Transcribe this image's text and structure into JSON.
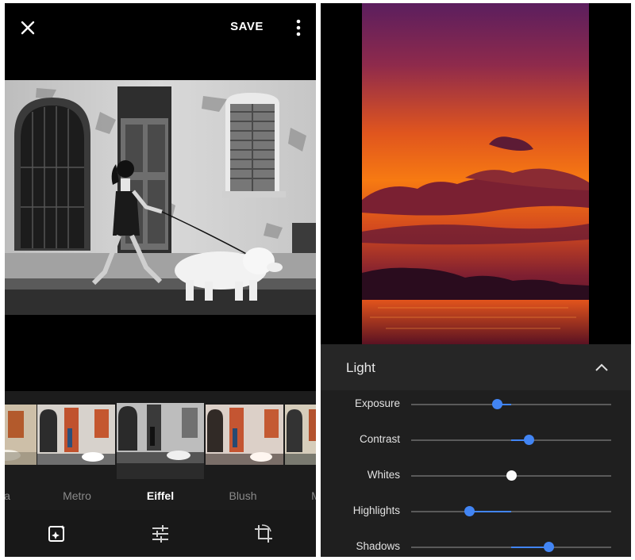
{
  "left": {
    "save_label": "SAVE",
    "filters": [
      {
        "label": "a",
        "selected": false
      },
      {
        "label": "Metro",
        "selected": false
      },
      {
        "label": "Eiffel",
        "selected": true
      },
      {
        "label": "Blush",
        "selected": false
      },
      {
        "label": "M",
        "selected": false
      }
    ]
  },
  "right": {
    "section_title": "Light",
    "sliders": [
      {
        "label": "Exposure",
        "value": 0.43,
        "center": 0.5
      },
      {
        "label": "Contrast",
        "value": 0.59,
        "center": 0.5
      },
      {
        "label": "Whites",
        "value": 0.5,
        "center": 0.5
      },
      {
        "label": "Highlights",
        "value": 0.29,
        "center": 0.5
      },
      {
        "label": "Shadows",
        "value": 0.69,
        "center": 0.5
      }
    ]
  },
  "colors": {
    "accent": "#4285f4",
    "neutral_thumb": "#fafafa"
  },
  "icons": [
    "close-icon",
    "more-vert-icon",
    "auto-enhance-icon",
    "tune-icon",
    "crop-rotate-icon",
    "chevron-up-icon"
  ]
}
